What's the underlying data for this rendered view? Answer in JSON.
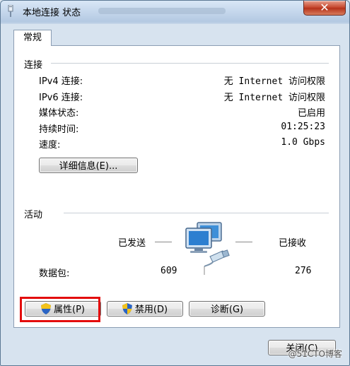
{
  "window": {
    "title": "本地连接 状态",
    "close_label": "✕"
  },
  "tabs": [
    {
      "label": "常规",
      "selected": true
    }
  ],
  "connection": {
    "group_label": "连接",
    "rows": [
      {
        "label": "IPv4 连接:",
        "value": "无 Internet 访问权限"
      },
      {
        "label": "IPv6 连接:",
        "value": "无 Internet 访问权限"
      },
      {
        "label": "媒体状态:",
        "value": "已启用"
      },
      {
        "label": "持续时间:",
        "value": "01:25:23"
      },
      {
        "label": "速度:",
        "value": "1.0 Gbps"
      }
    ],
    "details_button": "详细信息(E)..."
  },
  "activity": {
    "group_label": "活动",
    "sent_label": "已发送",
    "received_label": "已接收",
    "packets_label": "数据包:",
    "packets_sent": "609",
    "packets_received": "276"
  },
  "buttons": {
    "properties": "属性(P)",
    "disable": "禁用(D)",
    "diagnose": "诊断(G)",
    "close": "关闭(C)"
  },
  "highlight": {
    "target": "properties",
    "color": "#e30d0d"
  },
  "icons": {
    "title": "network-connection-icon",
    "activity": "network-computers-icon",
    "uac": "uac-shield-icon"
  },
  "watermark": "@51CTO博客"
}
